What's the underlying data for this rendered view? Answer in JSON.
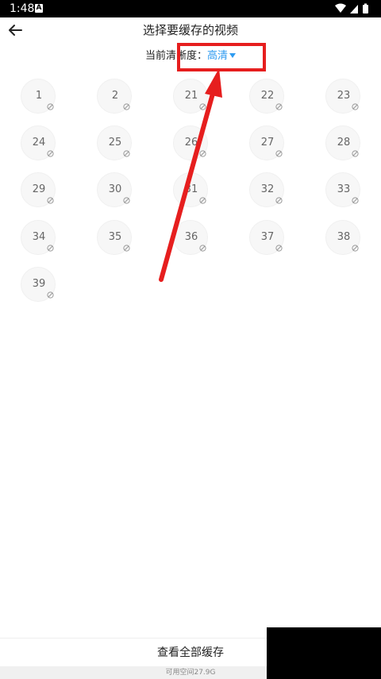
{
  "status_bar": {
    "time": "1:48",
    "app_icon_letter": "A",
    "icons": [
      "wifi-icon",
      "signal-icon",
      "battery-icon"
    ]
  },
  "header": {
    "title": "选择要缓存的视频",
    "back_icon": "back-arrow-icon"
  },
  "quality": {
    "label": "当前清晰度：",
    "value": "高清",
    "caret_icon": "caret-down-icon",
    "value_color": "#2e9bf0"
  },
  "episodes": [
    "1",
    "2",
    "21",
    "22",
    "23",
    "24",
    "25",
    "26",
    "27",
    "28",
    "29",
    "30",
    "31",
    "32",
    "33",
    "34",
    "35",
    "36",
    "37",
    "38",
    "39"
  ],
  "episode_badge_icon": "not-cached-icon",
  "footer": {
    "view_all_label": "查看全部缓存",
    "storage_text": "可用空间27.9G"
  },
  "annotation": {
    "color": "#e61e1e"
  }
}
